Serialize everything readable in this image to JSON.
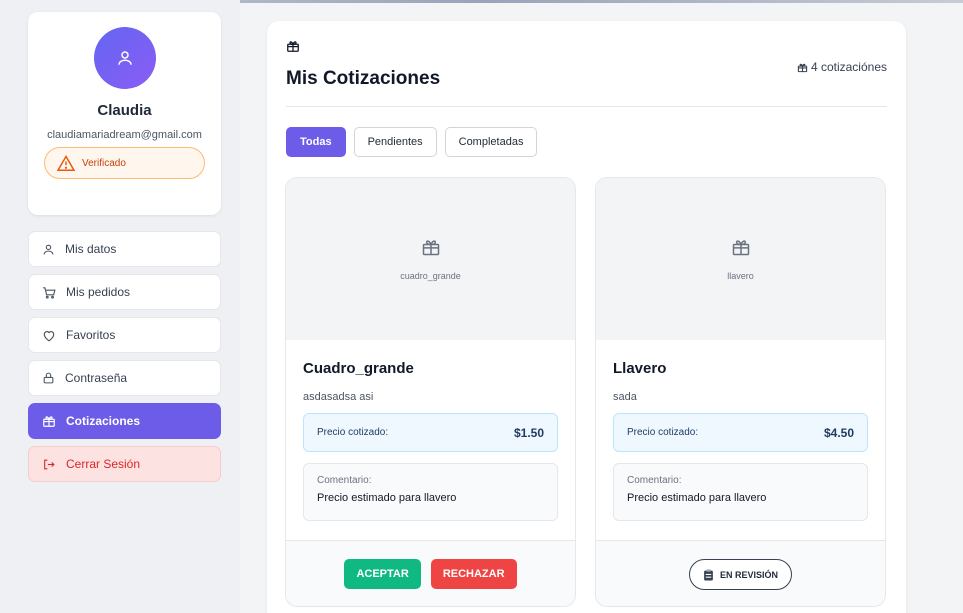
{
  "profile": {
    "name": "Claudia",
    "email": "claudiamariadream@gmail.com",
    "verified_label": "Verificado"
  },
  "menu": {
    "items": [
      {
        "label": "Mis datos",
        "icon": "user-icon"
      },
      {
        "label": "Mis pedidos",
        "icon": "cart-icon"
      },
      {
        "label": "Favoritos",
        "icon": "heart-icon"
      },
      {
        "label": "Contraseña",
        "icon": "lock-icon"
      },
      {
        "label": "Cotizaciones",
        "icon": "gift-icon",
        "active": true
      },
      {
        "label": "Cerrar Sesión",
        "icon": "logout-icon"
      }
    ]
  },
  "main": {
    "title": "Mis Cotizaciones",
    "count_label": "4 cotizaciónes",
    "tabs": [
      {
        "label": "Todas",
        "active": true
      },
      {
        "label": "Pendientes"
      },
      {
        "label": "Completadas"
      }
    ]
  },
  "quotes": [
    {
      "image_label": "cuadro_grande",
      "title": "Cuadro_grande",
      "description": "asdasadsa asi",
      "price_label": "Precio cotizado:",
      "price": "$1.50",
      "comment_label": "Comentario:",
      "comment": "Precio estimado para llavero",
      "accept_label": "ACEPTAR",
      "reject_label": "RECHAZAR"
    },
    {
      "image_label": "llavero",
      "title": "Llavero",
      "description": "sada",
      "price_label": "Precio cotizado:",
      "price": "$4.50",
      "comment_label": "Comentario:",
      "comment": "Precio estimado para llavero",
      "status_label": "EN REVISIÓN"
    }
  ],
  "colors": {
    "accent": "#6c5ce7",
    "accept": "#10b981",
    "reject": "#ef4444",
    "logout_bg": "#fde2e2"
  }
}
